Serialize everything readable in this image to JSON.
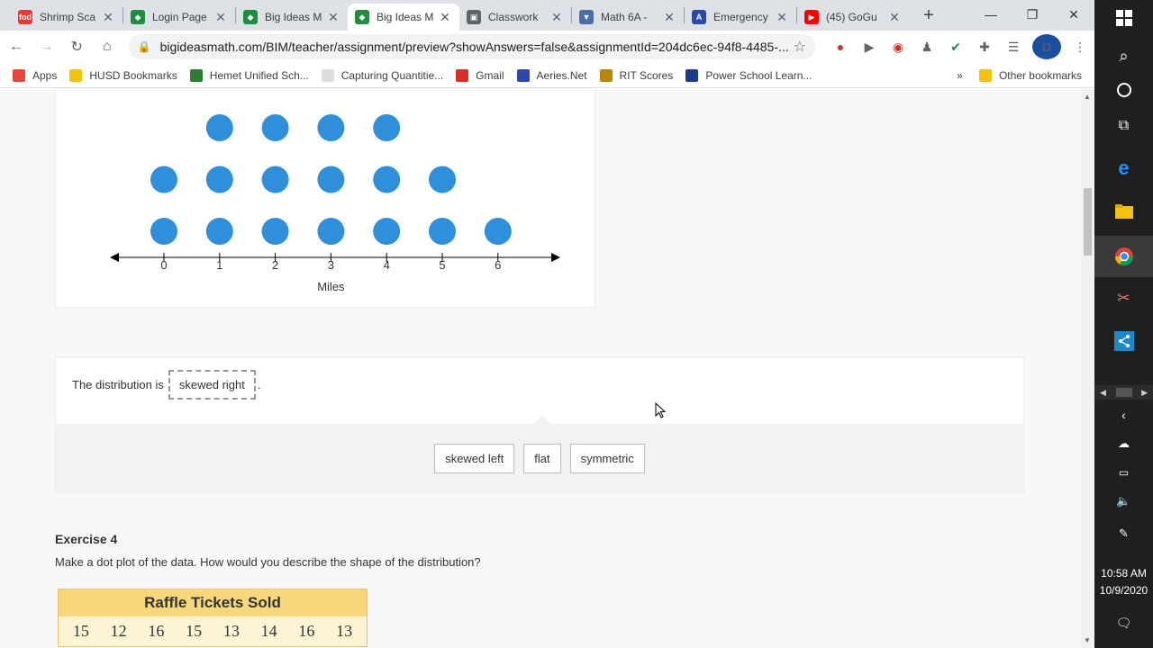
{
  "browser": {
    "tabs": [
      {
        "title": "Shrimp Sca",
        "color": "#e53935",
        "glyph": "fod"
      },
      {
        "title": "Login Page",
        "color": "#1e8e3e",
        "glyph": "◆"
      },
      {
        "title": "Big Ideas M",
        "color": "#1e8e3e",
        "glyph": "◆"
      },
      {
        "title": "Big Ideas M",
        "color": "#1e8e3e",
        "glyph": "◆",
        "active": true
      },
      {
        "title": "Classwork",
        "color": "#5f6368",
        "glyph": "▣"
      },
      {
        "title": "Math 6A -",
        "color": "#4a6fa5",
        "glyph": "▼"
      },
      {
        "title": "Emergency",
        "color": "#2b4aa8",
        "glyph": "A"
      },
      {
        "title": "(45) GoGu",
        "color": "#ff0000",
        "glyph": "▶"
      }
    ],
    "url": "bigideasmath.com/BIM/teacher/assignment/preview?showAnswers=false&assignmentId=204dc6ec-94f8-4485-...",
    "profile_initial": "D",
    "bookmarks": [
      {
        "label": "Apps",
        "color": "#e8453c"
      },
      {
        "label": "HUSD Bookmarks",
        "color": "#f4c20d"
      },
      {
        "label": "Hemet Unified Sch...",
        "color": "#2e7d32"
      },
      {
        "label": "Capturing Quantitie...",
        "color": "#dddddd"
      },
      {
        "label": "Gmail",
        "color": "#d93025"
      },
      {
        "label": "Aeries.Net",
        "color": "#2b4aa8"
      },
      {
        "label": "RIT Scores",
        "color": "#b8860b"
      },
      {
        "label": "Power School Learn...",
        "color": "#1a3c8b"
      }
    ],
    "other_bookmarks": "Other bookmarks",
    "more_chevron": "»"
  },
  "dot_plot": {
    "axis_label": "Miles",
    "ticks": [
      0,
      1,
      2,
      3,
      4,
      5,
      6
    ],
    "counts": [
      2,
      3,
      3,
      3,
      3,
      2,
      1
    ],
    "dot_color": "#2f8fdb"
  },
  "question": {
    "sentence_prefix": "The distribution is",
    "selected_answer": "skewed right",
    "period": ".",
    "options": [
      "skewed left",
      "flat",
      "symmetric"
    ]
  },
  "exercise": {
    "title": "Exercise 4",
    "prompt": "Make a dot plot of the data. How would you describe the shape of the distribution?",
    "table_title": "Raffle Tickets Sold",
    "table_values": [
      "15",
      "12",
      "16",
      "15",
      "13",
      "14",
      "16",
      "13"
    ]
  },
  "taskbar": {
    "time": "10:58 AM",
    "date": "10/9/2020"
  }
}
